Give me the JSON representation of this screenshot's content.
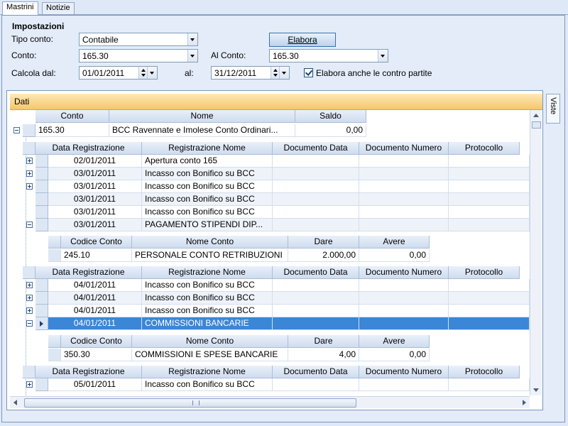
{
  "tabs": [
    {
      "label": "Mastrini"
    },
    {
      "label": "Notizie"
    }
  ],
  "settings": {
    "title": "Impostazioni",
    "tipo_conto_label": "Tipo conto:",
    "tipo_conto_value": "Contabile",
    "elabora_label": "Elabora",
    "conto_label": "Conto:",
    "conto_value": "165.30",
    "al_conto_label": "Al Conto:",
    "al_conto_value": "165.30",
    "calcola_dal_label": "Calcola dal:",
    "calcola_dal_value": "01/01/2011",
    "al_label": "al:",
    "al_value": "31/12/2011",
    "checkbox_label": "Elabora anche le contro partite",
    "checkbox_checked": true
  },
  "group": {
    "title": "Dati",
    "side_tab": "Viste"
  },
  "master": {
    "headers": [
      "Conto",
      "Nome",
      "Saldo"
    ],
    "row": {
      "conto": "165.30",
      "nome": "BCC Ravennate e Imolese Conto Ordinari...",
      "saldo": "0,00"
    }
  },
  "detail_headers": [
    "Data Registrazione",
    "Registrazione Nome",
    "Documento Data",
    "Documento Numero",
    "Protocollo"
  ],
  "sub_headers": [
    "Codice Conto",
    "Nome Conto",
    "Dare",
    "Avere"
  ],
  "block1": {
    "rows": [
      {
        "data": "02/01/2011",
        "nome": "Apertura conto 165"
      },
      {
        "data": "03/01/2011",
        "nome": "Incasso con Bonifico su BCC"
      },
      {
        "data": "03/01/2011",
        "nome": "Incasso con Bonifico su BCC"
      },
      {
        "data": "03/01/2011",
        "nome": "Incasso con Bonifico su BCC"
      },
      {
        "data": "03/01/2011",
        "nome": "Incasso con Bonifico su BCC"
      },
      {
        "data": "03/01/2011",
        "nome": "PAGAMENTO STIPENDI DIP..."
      }
    ],
    "sub": {
      "codice": "245.10",
      "nome": "PERSONALE CONTO RETRIBUZIONI",
      "dare": "2.000,00",
      "avere": "0,00"
    }
  },
  "block2": {
    "rows": [
      {
        "data": "04/01/2011",
        "nome": "Incasso con Bonifico su BCC"
      },
      {
        "data": "04/01/2011",
        "nome": "Incasso con Bonifico su BCC"
      },
      {
        "data": "04/01/2011",
        "nome": "Incasso con Bonifico su BCC"
      },
      {
        "data": "04/01/2011",
        "nome": "COMMISSIONI BANCARIE"
      }
    ],
    "sub": {
      "codice": "350.30",
      "nome": "COMMISSIONI E SPESE BANCARIE",
      "dare": "4,00",
      "avere": "0,00"
    }
  },
  "block3": {
    "rows": [
      {
        "data": "05/01/2011",
        "nome": "Incasso con Bonifico su BCC"
      }
    ]
  },
  "colors": {
    "accent": "#f7c66a",
    "selection": "#3b86d6",
    "background": "#dfe8f6"
  }
}
